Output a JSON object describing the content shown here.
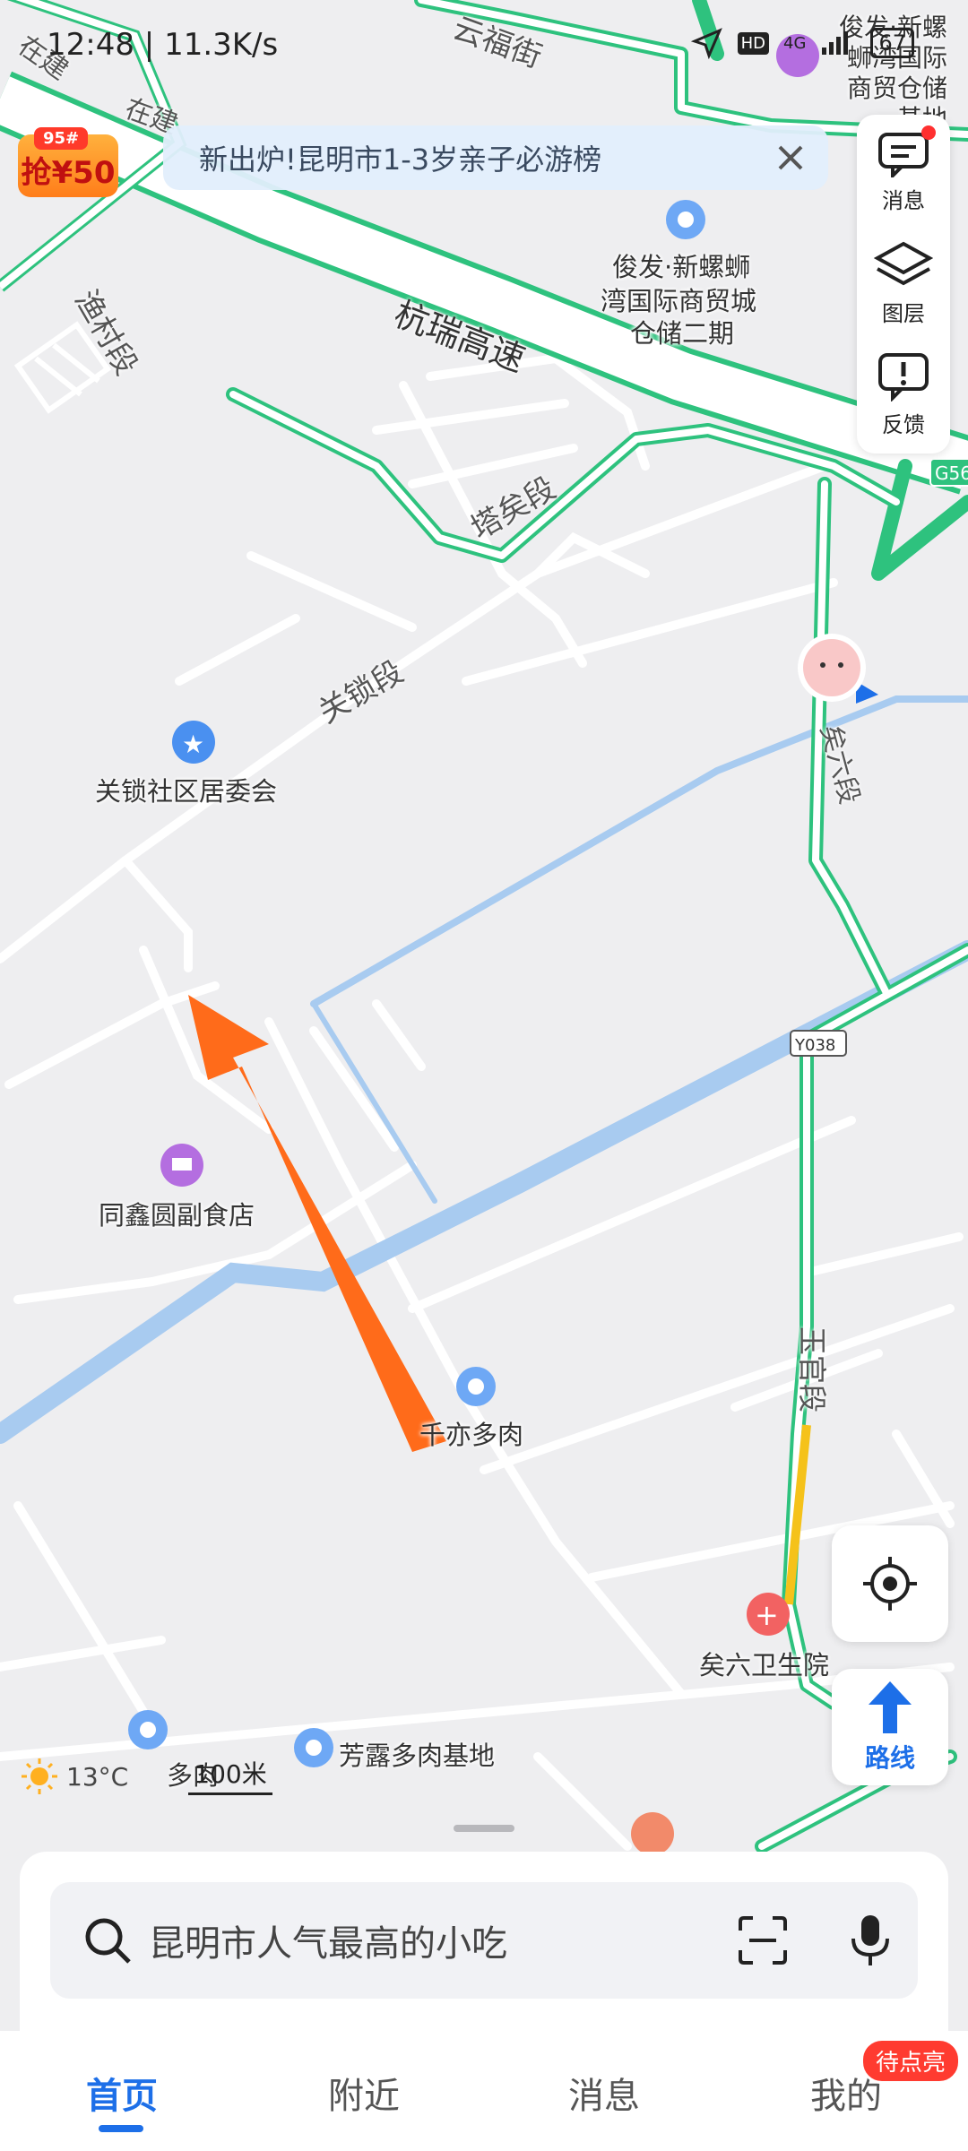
{
  "status_bar": {
    "time": "12:48",
    "speed": "11.3K/s",
    "network": "4G",
    "battery": "67"
  },
  "banner": {
    "text": "新出炉!昆明市1-3岁亲子必游榜",
    "close_icon": "close-icon"
  },
  "coupon": {
    "top_text": "95#",
    "text": "抢¥50"
  },
  "right_panel": {
    "items": [
      {
        "label": "消息",
        "icon": "message-icon"
      },
      {
        "label": "图层",
        "icon": "layers-icon"
      },
      {
        "label": "反馈",
        "icon": "feedback-icon"
      }
    ]
  },
  "map": {
    "road_labels": {
      "hangrui": "杭瑞高速",
      "tayi": "塔矣段",
      "guansuo": "关锁段",
      "yicun": "渔村段",
      "yunfu": "云福街",
      "yunfu2": "云福街",
      "zaijian": "在建",
      "zaijian2": "在建",
      "yiliu": "矣六段",
      "yuguan": "玉官段",
      "y038": "Y038",
      "g56": "G56"
    },
    "pois": {
      "junfa_top": "俊发·新螺蛳湾国际商贸仓储基地",
      "junfa_line1": "俊发·新螺蛳",
      "junfa_line2": "湾国际商贸城",
      "junfa_line3": "仓储二期",
      "guansuo": "关锁社区居委会",
      "tongxin": "同鑫圆副食店",
      "qianyi": "千亦多肉",
      "yiliu_hospital": "矣六卫生院",
      "fanglu": "芳露多肉基地",
      "bottom_left": "多肉"
    }
  },
  "weather": {
    "temp": "13°C"
  },
  "scale": {
    "text": "100米"
  },
  "route_button": {
    "label": "路线"
  },
  "search": {
    "placeholder": "昆明市人气最高的小吃"
  },
  "tabs": [
    {
      "label": "首页",
      "active": true
    },
    {
      "label": "附近",
      "active": false
    },
    {
      "label": "消息",
      "active": false
    },
    {
      "label": "我的",
      "active": false
    }
  ],
  "tab_badge": "待点亮",
  "colors": {
    "road_green": "#2ec27e",
    "river_blue": "#a8cbf0",
    "accent_blue": "#1d6fe8",
    "arrow_orange": "#ff6b1a",
    "map_bg": "#eeeef0"
  }
}
